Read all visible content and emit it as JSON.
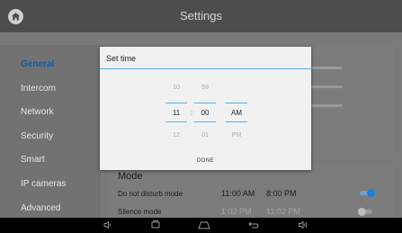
{
  "header": {
    "title": "Settings",
    "home_icon": "home-icon"
  },
  "sidebar": {
    "items": [
      {
        "label": "General",
        "active": true
      },
      {
        "label": "Intercom",
        "active": false
      },
      {
        "label": "Network",
        "active": false
      },
      {
        "label": "Security",
        "active": false
      },
      {
        "label": "Smart",
        "active": false
      },
      {
        "label": "IP cameras",
        "active": false
      },
      {
        "label": "Advanced",
        "active": false
      }
    ]
  },
  "dialog": {
    "title": "Set time",
    "hour": {
      "prev": "10",
      "selected": "11",
      "next": "12"
    },
    "minute": {
      "prev": "59",
      "selected": "00",
      "next": "01"
    },
    "ampm": {
      "selected": "AM",
      "next": "PM"
    },
    "separator": ":",
    "done_label": "DONE"
  },
  "mode": {
    "title": "Mode",
    "rows": [
      {
        "label": "Do not disturb mode",
        "start": "11:00 AM",
        "end": "8:00 PM",
        "enabled": true
      },
      {
        "label": "Silence mode",
        "start": "1:02 PM",
        "end": "11:02 PM",
        "enabled": false
      }
    ]
  },
  "navbar": {
    "icons": [
      "volume-down-icon",
      "recent-apps-icon",
      "home-nav-icon",
      "back-icon",
      "volume-up-icon"
    ]
  },
  "colors": {
    "accent": "#55aee6",
    "active_text": "#0b5ea9",
    "toggle_on": "#1e7fd8"
  }
}
